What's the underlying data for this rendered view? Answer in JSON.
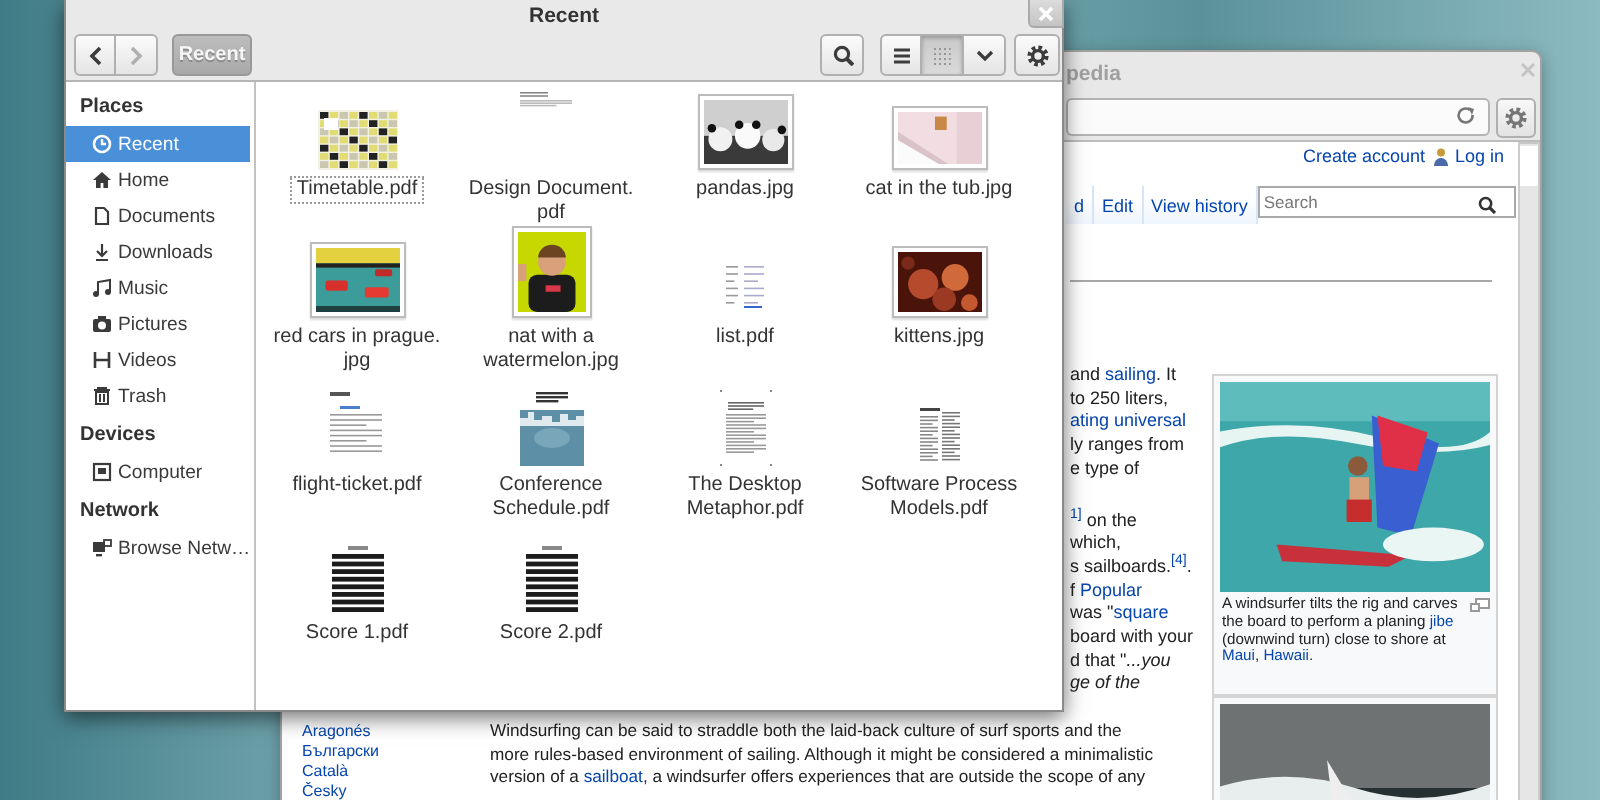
{
  "files_window": {
    "title": "Recent",
    "nav_buttons": [
      {
        "kind": "back",
        "disabled": false
      },
      {
        "kind": "forward",
        "disabled": true
      }
    ],
    "path_button": "Recent",
    "view_buttons": [
      {
        "kind": "list",
        "selected": false
      },
      {
        "kind": "grid",
        "selected": true
      }
    ],
    "sidebar": [
      {
        "heading": "Places",
        "items": [
          {
            "label": "Recent",
            "selected": true
          },
          {
            "label": "Home",
            "selected": false
          },
          {
            "label": "Documents",
            "selected": false
          },
          {
            "label": "Downloads",
            "selected": false
          },
          {
            "label": "Music",
            "selected": false
          },
          {
            "label": "Pictures",
            "selected": false
          },
          {
            "label": "Videos",
            "selected": false
          },
          {
            "label": "Trash",
            "selected": false
          }
        ]
      },
      {
        "heading": "Devices",
        "items": [
          {
            "label": "Computer",
            "selected": false
          }
        ]
      },
      {
        "heading": "Network",
        "items": [
          {
            "label": "Browse Netw…",
            "selected": false
          }
        ]
      }
    ],
    "files": [
      {
        "lines": [
          "Timetable.pdf"
        ],
        "kind": "document",
        "focused": true
      },
      {
        "lines": [
          "Design Document.",
          "pdf"
        ],
        "kind": "document",
        "focused": false
      },
      {
        "lines": [
          "pandas.jpg"
        ],
        "focused": false
      },
      {
        "lines": [
          "cat in the tub.jpg"
        ],
        "focused": false
      },
      {
        "lines": [
          "red cars in prague.",
          "jpg"
        ],
        "focused": false
      },
      {
        "lines": [
          "nat with a",
          "watermelon.jpg"
        ],
        "focused": false
      },
      {
        "lines": [
          "list.pdf"
        ],
        "kind": "document",
        "focused": false
      },
      {
        "lines": [
          "kittens.jpg"
        ],
        "focused": false
      },
      {
        "lines": [
          "flight-ticket.pdf"
        ],
        "kind": "document",
        "focused": false
      },
      {
        "lines": [
          "Conference",
          "Schedule.pdf"
        ],
        "kind": "document",
        "focused": false
      },
      {
        "lines": [
          "The Desktop",
          "Metaphor.pdf"
        ],
        "kind": "document",
        "focused": false
      },
      {
        "lines": [
          "Software Process",
          "Models.pdf"
        ],
        "kind": "document",
        "focused": false
      },
      {
        "lines": [
          "Score 1.pdf"
        ],
        "kind": "document",
        "focused": false
      },
      {
        "lines": [
          "Score 2.pdf"
        ],
        "kind": "document",
        "focused": false
      }
    ]
  },
  "browser_window": {
    "title": "pedia",
    "account_links": [
      "Create account",
      "Log in"
    ],
    "tabs": [
      {
        "label": "d",
        "selected": false
      },
      {
        "label": "Edit",
        "selected": false
      },
      {
        "label": "View history",
        "selected": false
      }
    ],
    "search": {
      "placeholder": "Search"
    },
    "fragment_groups": [
      [
        [
          {
            "text": "and ",
            "kind": "plain"
          },
          {
            "text": "sailing",
            "kind": "link"
          },
          {
            "text": ". It",
            "kind": "plain"
          }
        ],
        [
          {
            "text": "to 250 liters,",
            "kind": "plain"
          }
        ],
        [
          {
            "text": "ating universal",
            "kind": "link"
          }
        ],
        [
          {
            "text": "ly ranges from",
            "kind": "plain"
          }
        ],
        [
          {
            "text": "e type of",
            "kind": "plain"
          }
        ]
      ],
      [
        [
          {
            "text": "1]",
            "kind": "ref"
          },
          {
            "text": " on the",
            "kind": "plain"
          }
        ],
        [
          {
            "text": "which,",
            "kind": "plain"
          }
        ],
        [
          {
            "text": "s sailboards.",
            "kind": "plain"
          },
          {
            "text": "[4]",
            "kind": "ref"
          },
          {
            "text": ".",
            "kind": "plain"
          }
        ],
        [
          {
            "text": "f ",
            "kind": "plain"
          },
          {
            "text": "Popular",
            "kind": "link"
          }
        ],
        [
          {
            "text": "was \"",
            "kind": "plain"
          },
          {
            "text": "square",
            "kind": "link"
          }
        ],
        [
          {
            "text": "board with your",
            "kind": "plain"
          }
        ],
        [
          {
            "text": "d that \"",
            "kind": "plain"
          },
          {
            "text": "...you",
            "kind": "italic"
          }
        ],
        [
          {
            "text": "ge of the",
            "kind": "italic"
          }
        ]
      ]
    ],
    "figures": [
      {
        "kind": "picture",
        "caption": [
          {
            "text": "A windsurfer tilts the rig and carves the board to perform a planing ",
            "kind": "plain"
          },
          {
            "text": "jibe",
            "kind": "link"
          },
          {
            "text": " (downwind turn) close to shore at ",
            "kind": "plain"
          },
          {
            "text": "Maui",
            "kind": "link"
          },
          {
            "text": ", ",
            "kind": "plain"
          },
          {
            "text": "Hawaii",
            "kind": "link"
          },
          {
            "text": ".",
            "kind": "plain"
          }
        ]
      },
      {
        "kind": "picture"
      }
    ],
    "languages": [
      "Aragonés",
      "Български",
      "Català",
      "Česky"
    ],
    "paragraph": [
      [
        {
          "text": "Windsurfing can be said to straddle both the laid-back culture of surf sports and the",
          "kind": "plain"
        }
      ],
      [
        {
          "text": "more rules-based environment of sailing. Although it might be considered a minimalistic",
          "kind": "plain"
        }
      ],
      [
        {
          "text": "version of a ",
          "kind": "plain"
        },
        {
          "text": "sailboat",
          "kind": "link"
        },
        {
          "text": ", a windsurfer offers experiences that are outside the scope of any",
          "kind": "plain"
        }
      ]
    ]
  }
}
